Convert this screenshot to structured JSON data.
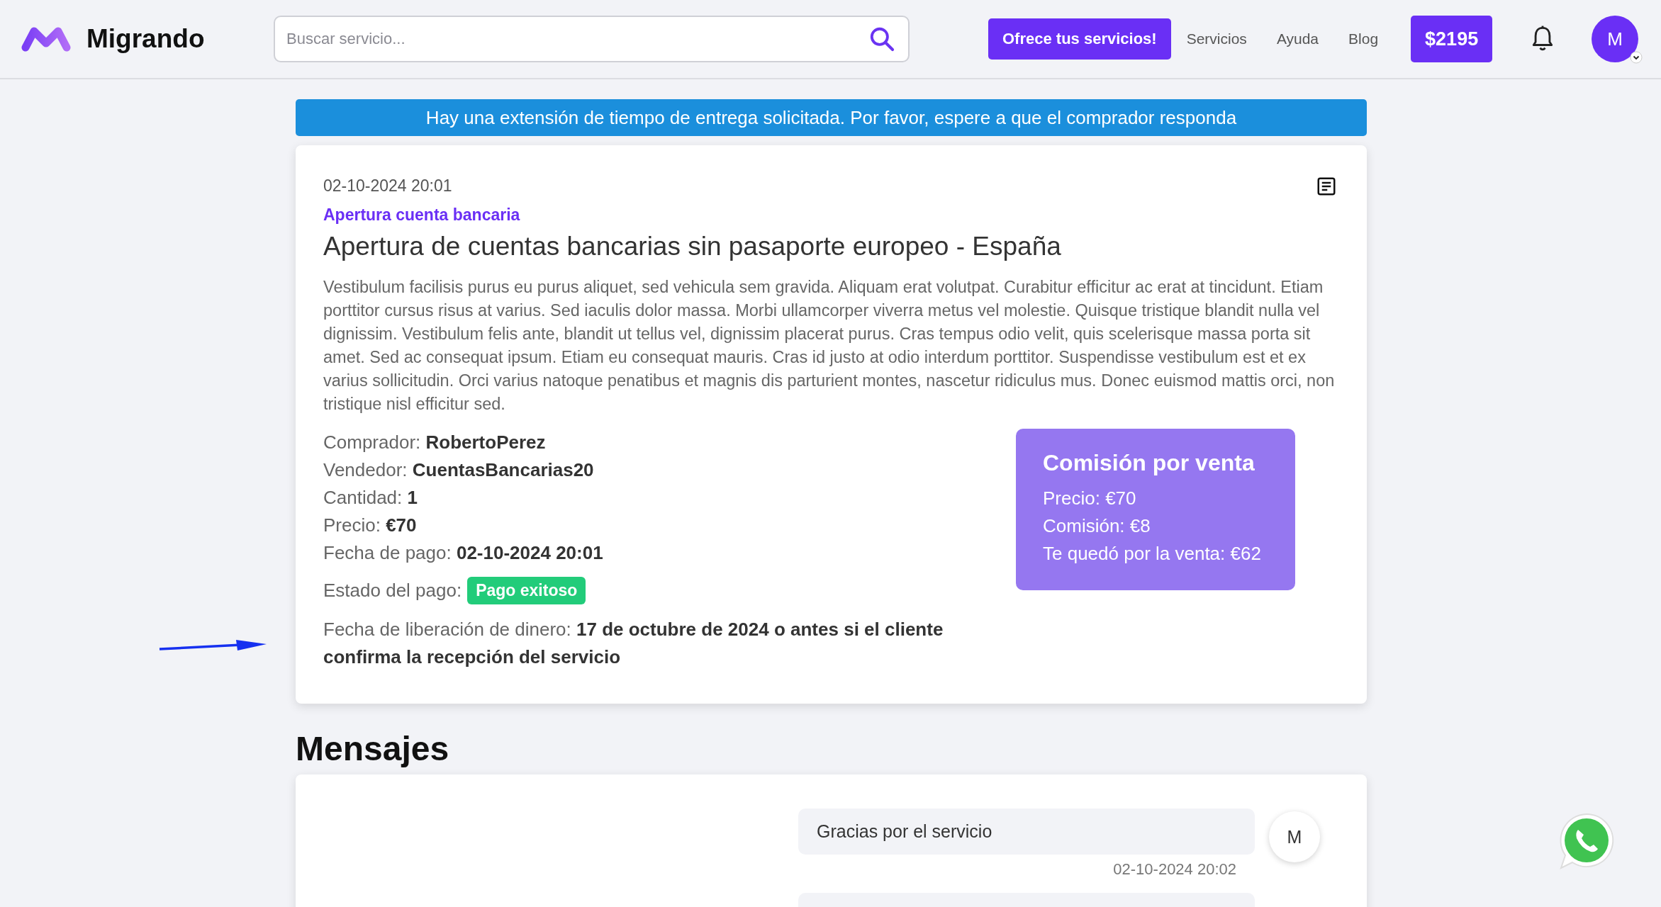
{
  "header": {
    "brand": "Migrando",
    "search": {
      "placeholder": "Buscar servicio..."
    },
    "cta": "Ofrece tus servicios!",
    "nav": [
      {
        "label": "Servicios"
      },
      {
        "label": "Ayuda"
      },
      {
        "label": "Blog"
      }
    ],
    "balance": "$2195",
    "avatar": "M"
  },
  "banner": "Hay una extensión de tiempo de entrega solicitada. Por favor, espere a que el comprador responda",
  "order": {
    "date": "02-10-2024 20:01",
    "category": "Apertura cuenta bancaria",
    "title": "Apertura de cuentas bancarias sin pasaporte europeo - España",
    "description": "Vestibulum facilisis purus eu purus aliquet, sed vehicula sem gravida. Aliquam erat volutpat. Curabitur efficitur ac erat at tincidunt. Etiam porttitor cursus risus at varius. Sed iaculis dolor massa. Morbi ullamcorper viverra metus vel molestie. Quisque tristique blandit nulla vel dignissim. Vestibulum felis ante, blandit ut tellus vel, dignissim placerat purus. Cras tempus odio velit, quis scelerisque massa porta sit amet. Sed ac consequat ipsum. Etiam eu consequat mauris. Cras id justo at odio interdum porttitor. Suspendisse vestibulum est et ex varius sollicitudin. Orci varius natoque penatibus et magnis dis parturient montes, nascetur ridiculus mus. Donec euismod mattis orci, non tristique nisl efficitur sed.",
    "details": [
      {
        "label": "Comprador:",
        "value": "RobertoPerez"
      },
      {
        "label": "Vendedor:",
        "value": "CuentasBancarias20"
      },
      {
        "label": "Cantidad:",
        "value": "1"
      },
      {
        "label": "Precio:",
        "value": "€70"
      },
      {
        "label": "Fecha de pago:",
        "value": "02-10-2024 20:01"
      }
    ],
    "payment_status": {
      "label": "Estado del pago:",
      "badge": "Pago exitoso"
    },
    "release": {
      "label": "Fecha de liberación de dinero:",
      "value": "17 de octubre de 2024 o antes si el cliente confirma la recepción del servicio"
    },
    "commission": {
      "title": "Comisión por venta",
      "lines": [
        "Precio: €70",
        "Comisión: €8",
        "Te quedó por la venta: €62"
      ]
    }
  },
  "messages": {
    "title": "Mensajes",
    "items": [
      {
        "text": "Gracias por el servicio",
        "time": "02-10-2024 20:02",
        "avatar": "M"
      }
    ]
  }
}
